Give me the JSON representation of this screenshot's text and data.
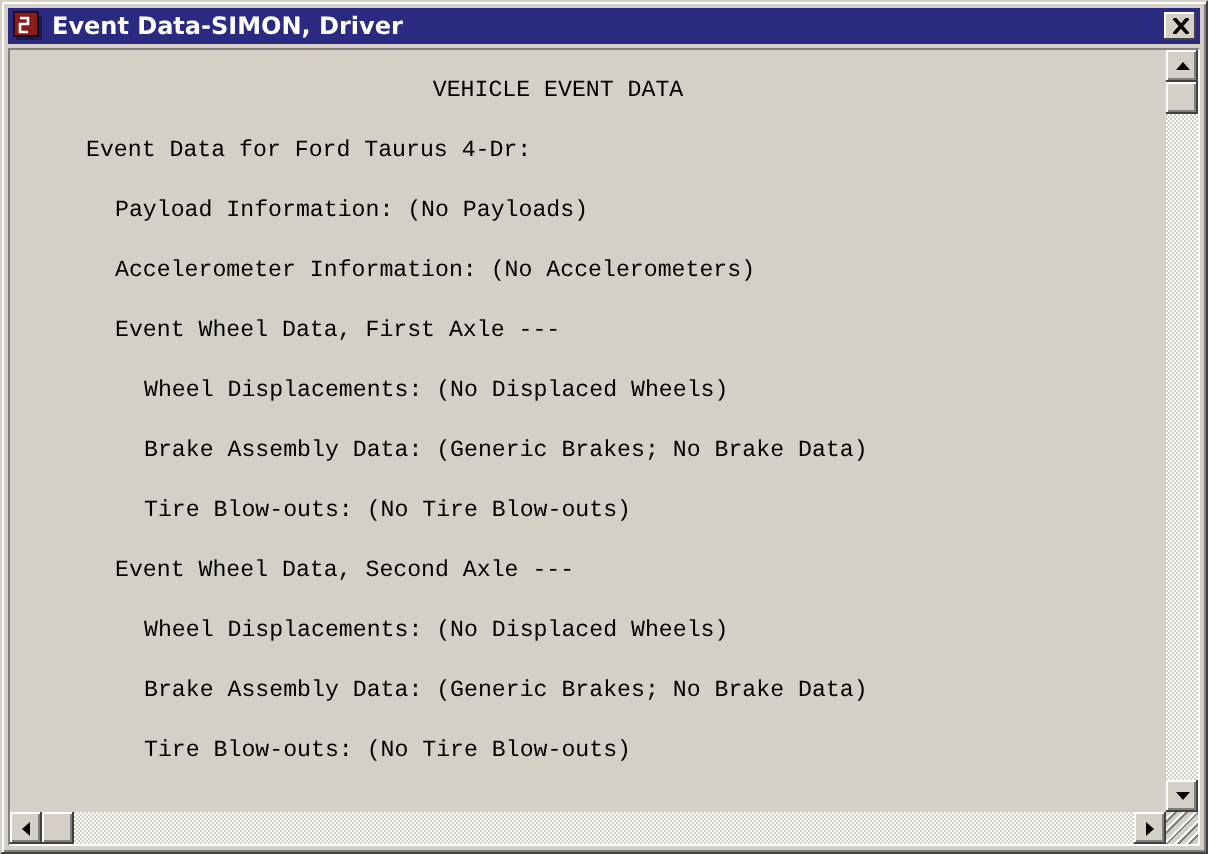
{
  "window": {
    "title": "Event Data-SIMON, Driver"
  },
  "heading": "VEHICLE EVENT DATA",
  "outline": [
    {
      "text": "Event Data for Ford Taurus 4-Dr:",
      "children": [
        {
          "text": "Payload Information: (No Payloads)"
        },
        {
          "text": "Accelerometer Information: (No Accelerometers)"
        },
        {
          "text": "Event Wheel Data, First Axle ---",
          "children": [
            {
              "text": "Wheel Displacements: (No Displaced Wheels)"
            },
            {
              "text": "Brake Assembly Data: (Generic Brakes; No Brake Data)"
            },
            {
              "text": "Tire Blow-outs: (No Tire Blow-outs)"
            }
          ]
        },
        {
          "text": "Event Wheel Data, Second Axle ---",
          "children": [
            {
              "text": "Wheel Displacements: (No Displaced Wheels)"
            },
            {
              "text": "Brake Assembly Data: (Generic Brakes; No Brake Data)"
            },
            {
              "text": "Tire Blow-outs: (No Tire Blow-outs)"
            }
          ]
        }
      ]
    }
  ]
}
